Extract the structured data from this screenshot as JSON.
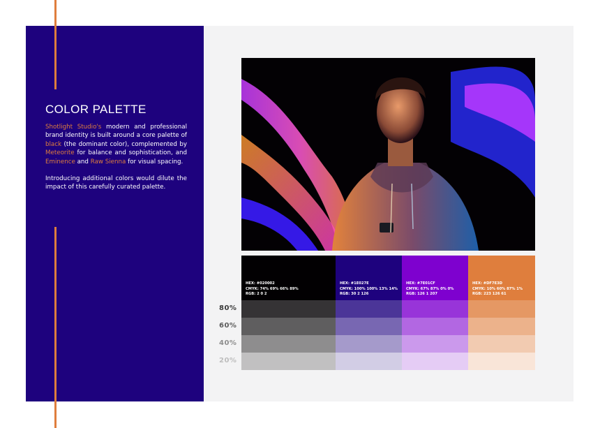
{
  "page": {
    "title": "COLOR PALETTE",
    "paragraph1": {
      "brand": "Shotlight Studio's",
      "t1": " modern and professional brand identity is built around a core palette of ",
      "black": "black",
      "t2": " (the dominant color), complemented by ",
      "meteorite": "Meteorite",
      "t3": " for balance and sophistication, and ",
      "eminence": "Eminence",
      "t4": " and ",
      "rawsienna": "Raw Sienna",
      "t5": " for visual spacing."
    },
    "paragraph2": "Introducing additional colors would dilute the impact of this carefully curated palette."
  },
  "colors": {
    "accent": "#df7e3d",
    "left_panel": "#1e027e",
    "right_panel": "#f3f3f4"
  },
  "swatches": [
    {
      "hex": "HEX: #020002",
      "cmyk": "CMYK: 74% 69% 66% 89%",
      "rgb": "RGB: 2 0 2",
      "color": "#020002",
      "tints": [
        "#353335",
        "#5f5e5f",
        "#8e8d8e",
        "#c1c0c1"
      ]
    },
    {
      "hex": "HEX: #1E027E",
      "cmyk": "CMYK: 100% 100% 13% 14%",
      "rgb": "RGB: 30 2 126",
      "color": "#1e027e",
      "tints": [
        "#4b3598",
        "#7867b2",
        "#a59acb",
        "#d2cde5"
      ]
    },
    {
      "hex": "HEX: #7E01CF",
      "cmyk": "CMYK: 67% 87% 0% 0%",
      "rgb": "RGB: 126 1 207",
      "color": "#7e01cf",
      "tints": [
        "#9834d9",
        "#b267e2",
        "#cb99ec",
        "#e5ccf5"
      ]
    },
    {
      "hex": "HEX: #DF7E3D",
      "cmyk": "CMYK: 10% 60% 87% 1%",
      "rgb": "RGB: 223 126 61",
      "color": "#df7e3d",
      "tints": [
        "#e59864",
        "#ecb28b",
        "#f2cbb1",
        "#f9e5d8"
      ]
    }
  ],
  "percent_labels": [
    "80%",
    "60%",
    "40%",
    "20%"
  ],
  "percent_colors": [
    "#3a3a3a",
    "#5c5c5c",
    "#8d8d8d",
    "#bdbdbd"
  ],
  "photo": {
    "logo_icon": "shotlight-logo-icon"
  }
}
